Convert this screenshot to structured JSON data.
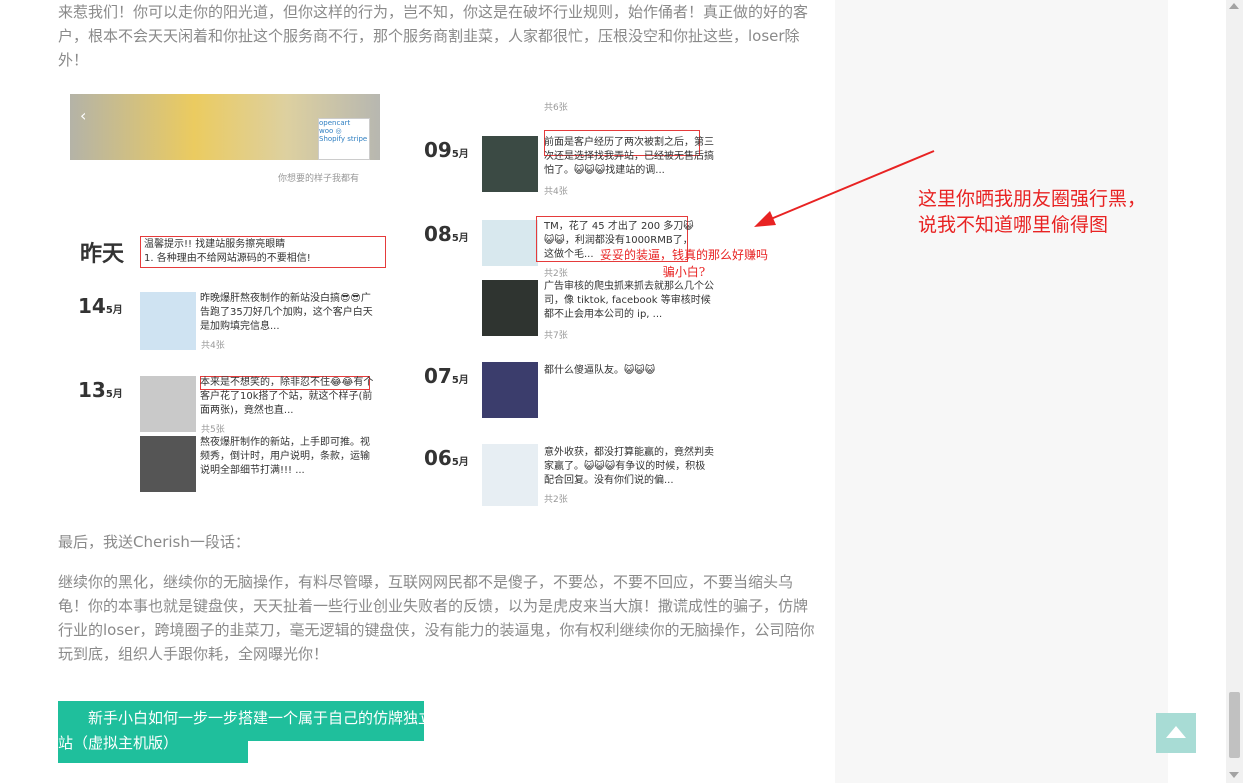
{
  "article": {
    "para1": "来惹我们！你可以走你的阳光道，但你这样的行为，岂不知，你这是在破坏行业规则，始作俑者！真正做的好的客户，根本不会天天闲着和你扯这个服务商不行，那个服务商割韭菜，人家都很忙，压根没空和你扯这些，loser除外！",
    "para2": "最后，我送Cherish一段话：",
    "para3": "继续你的黑化，继续你的无脑操作，有料尽管曝，互联网网民都不是傻子，不要怂，不要不回应，不要当缩头乌龟！你的本事也就是键盘侠，天天扯着一些行业创业失败者的反馈，以为是虎皮来当大旗！撒谎成性的骗子，仿牌行业的loser，跨境圈子的韭菜刀，毫无逻辑的键盘侠，没有能力的装逼鬼，你有权利继续你的无脑操作，公司陪你玩到底，组织人手跟你耗，全网曝光你！",
    "cta_label": "新手小白如何一步一步搭建一个属于自己的仿牌独立站（虚拟主机版）"
  },
  "screenshot": {
    "caption": "你想要的样子我都有",
    "yesterday": "昨天",
    "notice": "温馨提示!! 找建站服务擦亮眼睛\n1. 各种理由不给网站源码的不要相信!",
    "entries_left": [
      {
        "day": "14",
        "month": "5月",
        "text": "昨晚爆肝熬夜制作的新站没白搞😎😎广告跑了35刀好几个加购，这个客户白天是加购填完信息...",
        "count": "共4张"
      },
      {
        "day": "13",
        "month": "5月",
        "text": "本来是不想笑的，除非忍不住😂😂有个客户花了10k搭了个站，就这个样子(前面两张)，竟然也直...",
        "count": "共5张"
      },
      {
        "day": "",
        "month": "",
        "text": "熬夜爆肝制作的新站，上手即可推。视频秀，倒计时，用户说明，条款，运输说明全部细节打满!!! ...",
        "count": ""
      }
    ],
    "entries_right": [
      {
        "day": "",
        "month": "",
        "text": "",
        "count": "共6张"
      },
      {
        "day": "09",
        "month": "5月",
        "text": "前面是客户经历了两次被割之后，第三次还是选择找我弄站，已经被无售后搞怕了。😺😺😺找建站的调...",
        "count": "共4张"
      },
      {
        "day": "08",
        "month": "5月",
        "text": "TM，花了 45 才出了 200 多刀😺😺😺，利润都没有1000RMB了，这做个毛...",
        "count": "共2张"
      },
      {
        "day": "",
        "month": "",
        "text": "广告审核的爬虫抓来抓去就那么几个公司，像 tiktok, facebook 等审核时候都不止会用本公司的 ip, ...",
        "count": "共7张"
      },
      {
        "day": "07",
        "month": "5月",
        "text": "都什么傻逼队友。😺😺😺",
        "count": ""
      },
      {
        "day": "06",
        "month": "5月",
        "text": "意外收获，都没打算能赢的，竟然判卖家赢了。😺😺😺有争议的时候，积极配合回复。没有你们说的偏...",
        "count": "共2张"
      }
    ],
    "handwritten_note": "妥妥的装逼，钱真的那么好赚吗\n骗小白?"
  },
  "callout": "这里你晒我朋友圈强行黑，\n说我不知道哪里偷得图"
}
